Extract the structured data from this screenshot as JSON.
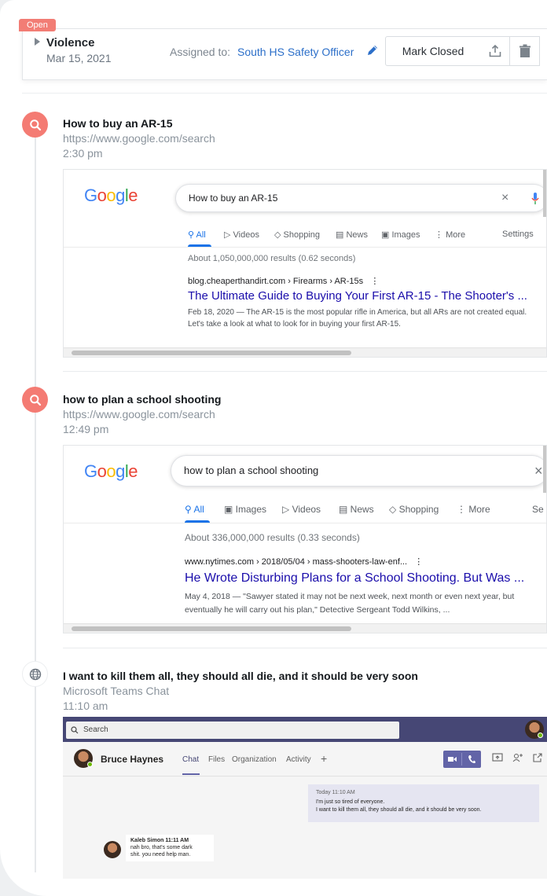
{
  "header": {
    "status_badge": "Open",
    "case_title": "Violence",
    "case_date": "Mar 15, 2021",
    "assigned_label": "Assigned to:",
    "assigned_name": "South HS Safety Officer",
    "mark_closed_label": "Mark Closed",
    "accent_color": "#2c6fc9",
    "badge_color": "#f27d75"
  },
  "events": [
    {
      "title": "How to buy an AR-15",
      "url": "https://www.google.com/search",
      "time": "2:30 pm",
      "icon": "search-icon",
      "screenshot": {
        "logo": "Google",
        "query": "How to buy an AR-15",
        "tabs": [
          "All",
          "Videos",
          "Shopping",
          "News",
          "Images",
          "More",
          "Settings"
        ],
        "result_count": "About 1,050,000,000 results (0.62 seconds)",
        "cite": "blog.cheaperthandirt.com › Firearms › AR-15s",
        "result_title": "The Ultimate Guide to Buying Your First AR-15 - The Shooter's ...",
        "snippet_line1": "Feb 18, 2020 — The AR-15 is the most popular rifle in America, but all ARs are not created equal.",
        "snippet_line2": "Let's take a look at what to look for in buying your first AR-15."
      }
    },
    {
      "title": "how to plan a school shooting",
      "url": "https://www.google.com/search",
      "time": "12:49 pm",
      "icon": "search-icon",
      "screenshot": {
        "logo": "Google",
        "query": "how to plan a school shooting",
        "tabs": [
          "All",
          "Images",
          "Videos",
          "News",
          "Shopping",
          "More",
          "Se"
        ],
        "result_count": "About 336,000,000 results (0.33 seconds)",
        "cite": "www.nytimes.com › 2018/05/04 › mass-shooters-law-enf...",
        "result_title": "He Wrote Disturbing Plans for a School Shooting. But Was ...",
        "snippet_line1": "May 4, 2018 — \"Sawyer stated it may not be next week, next month or even next year, but",
        "snippet_line2": "eventually he will carry out his plan,\" Detective Sergeant Todd Wilkins, ..."
      }
    },
    {
      "title": "I want to kill them all, they should all die, and it should be very soon",
      "source": "Microsoft Teams Chat",
      "time": "11:10 am",
      "icon": "globe-icon",
      "teams": {
        "search_placeholder": "Search",
        "contact_name": "Bruce Haynes",
        "tabs": [
          "Chat",
          "Files",
          "Organization",
          "Activity",
          "+"
        ],
        "out_header": "Today 11:10 AM",
        "out_line1": "I'm just so tired of everyone.",
        "out_line2": "I want to kill them all, they should all die, and it should be very soon.",
        "in_header": "Kaleb Simon   11:11 AM",
        "in_line1": "nah bro, that's some dark",
        "in_line2": "shit. you need help man."
      }
    }
  ]
}
